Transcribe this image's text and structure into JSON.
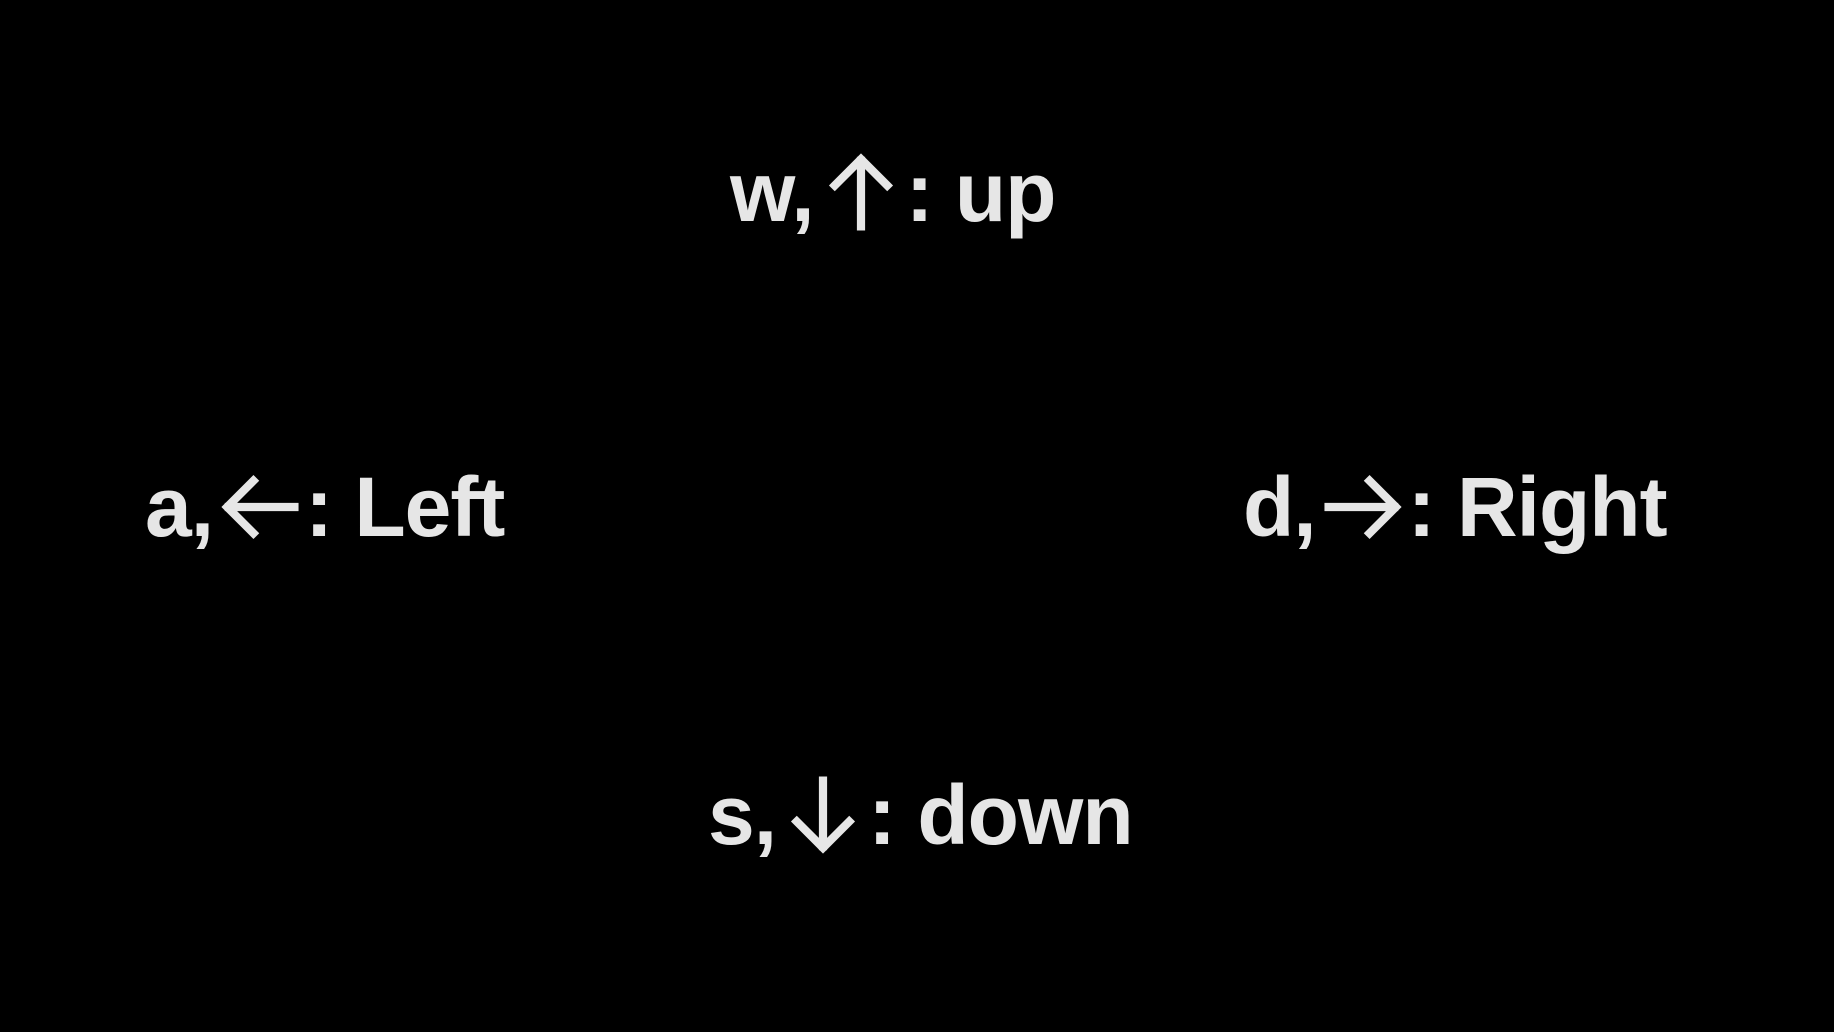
{
  "controls": {
    "up": {
      "keys": "w,",
      "arrow_icon": "arrow-up-icon",
      "action": ": up"
    },
    "left": {
      "keys": "a,",
      "arrow_icon": "arrow-left-icon",
      "action": ": Left"
    },
    "right": {
      "keys": "d,",
      "arrow_icon": "arrow-right-icon",
      "action": ": Right"
    },
    "down": {
      "keys": "s,",
      "arrow_icon": "arrow-down-icon",
      "action": ": down"
    }
  },
  "colors": {
    "background": "#000000",
    "text": "#e6e6e6"
  }
}
